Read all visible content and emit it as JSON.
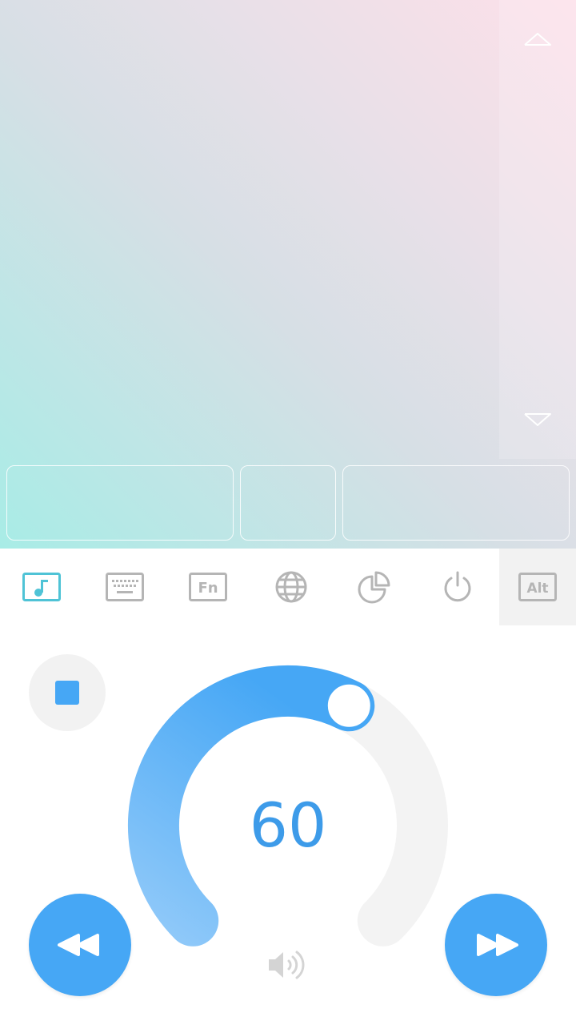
{
  "toolbar": {
    "items": [
      {
        "name": "music-mode",
        "icon": "music-note-icon",
        "active": true
      },
      {
        "name": "keyboard-mode",
        "icon": "keyboard-icon",
        "active": false
      },
      {
        "name": "function-keys",
        "icon": "fn-key-icon",
        "label": "Fn",
        "active": false
      },
      {
        "name": "browser",
        "icon": "globe-icon",
        "active": false
      },
      {
        "name": "system-monitor",
        "icon": "pie-chart-icon",
        "active": false
      },
      {
        "name": "power",
        "icon": "power-icon",
        "active": false
      },
      {
        "name": "alt-key",
        "icon": "alt-key-icon",
        "label": "Alt",
        "active": false
      }
    ]
  },
  "media": {
    "volume": 60,
    "volume_max": 100,
    "stop_icon": "stop-icon",
    "rewind_icon": "rewind-icon",
    "forward_icon": "fast-forward-icon",
    "speaker_icon": "speaker-icon"
  },
  "colors": {
    "accent": "#46a7f5",
    "active_tool": "#4fc3d6",
    "inactive_tool": "#b5b5b5",
    "track": "#f3f3f3"
  }
}
